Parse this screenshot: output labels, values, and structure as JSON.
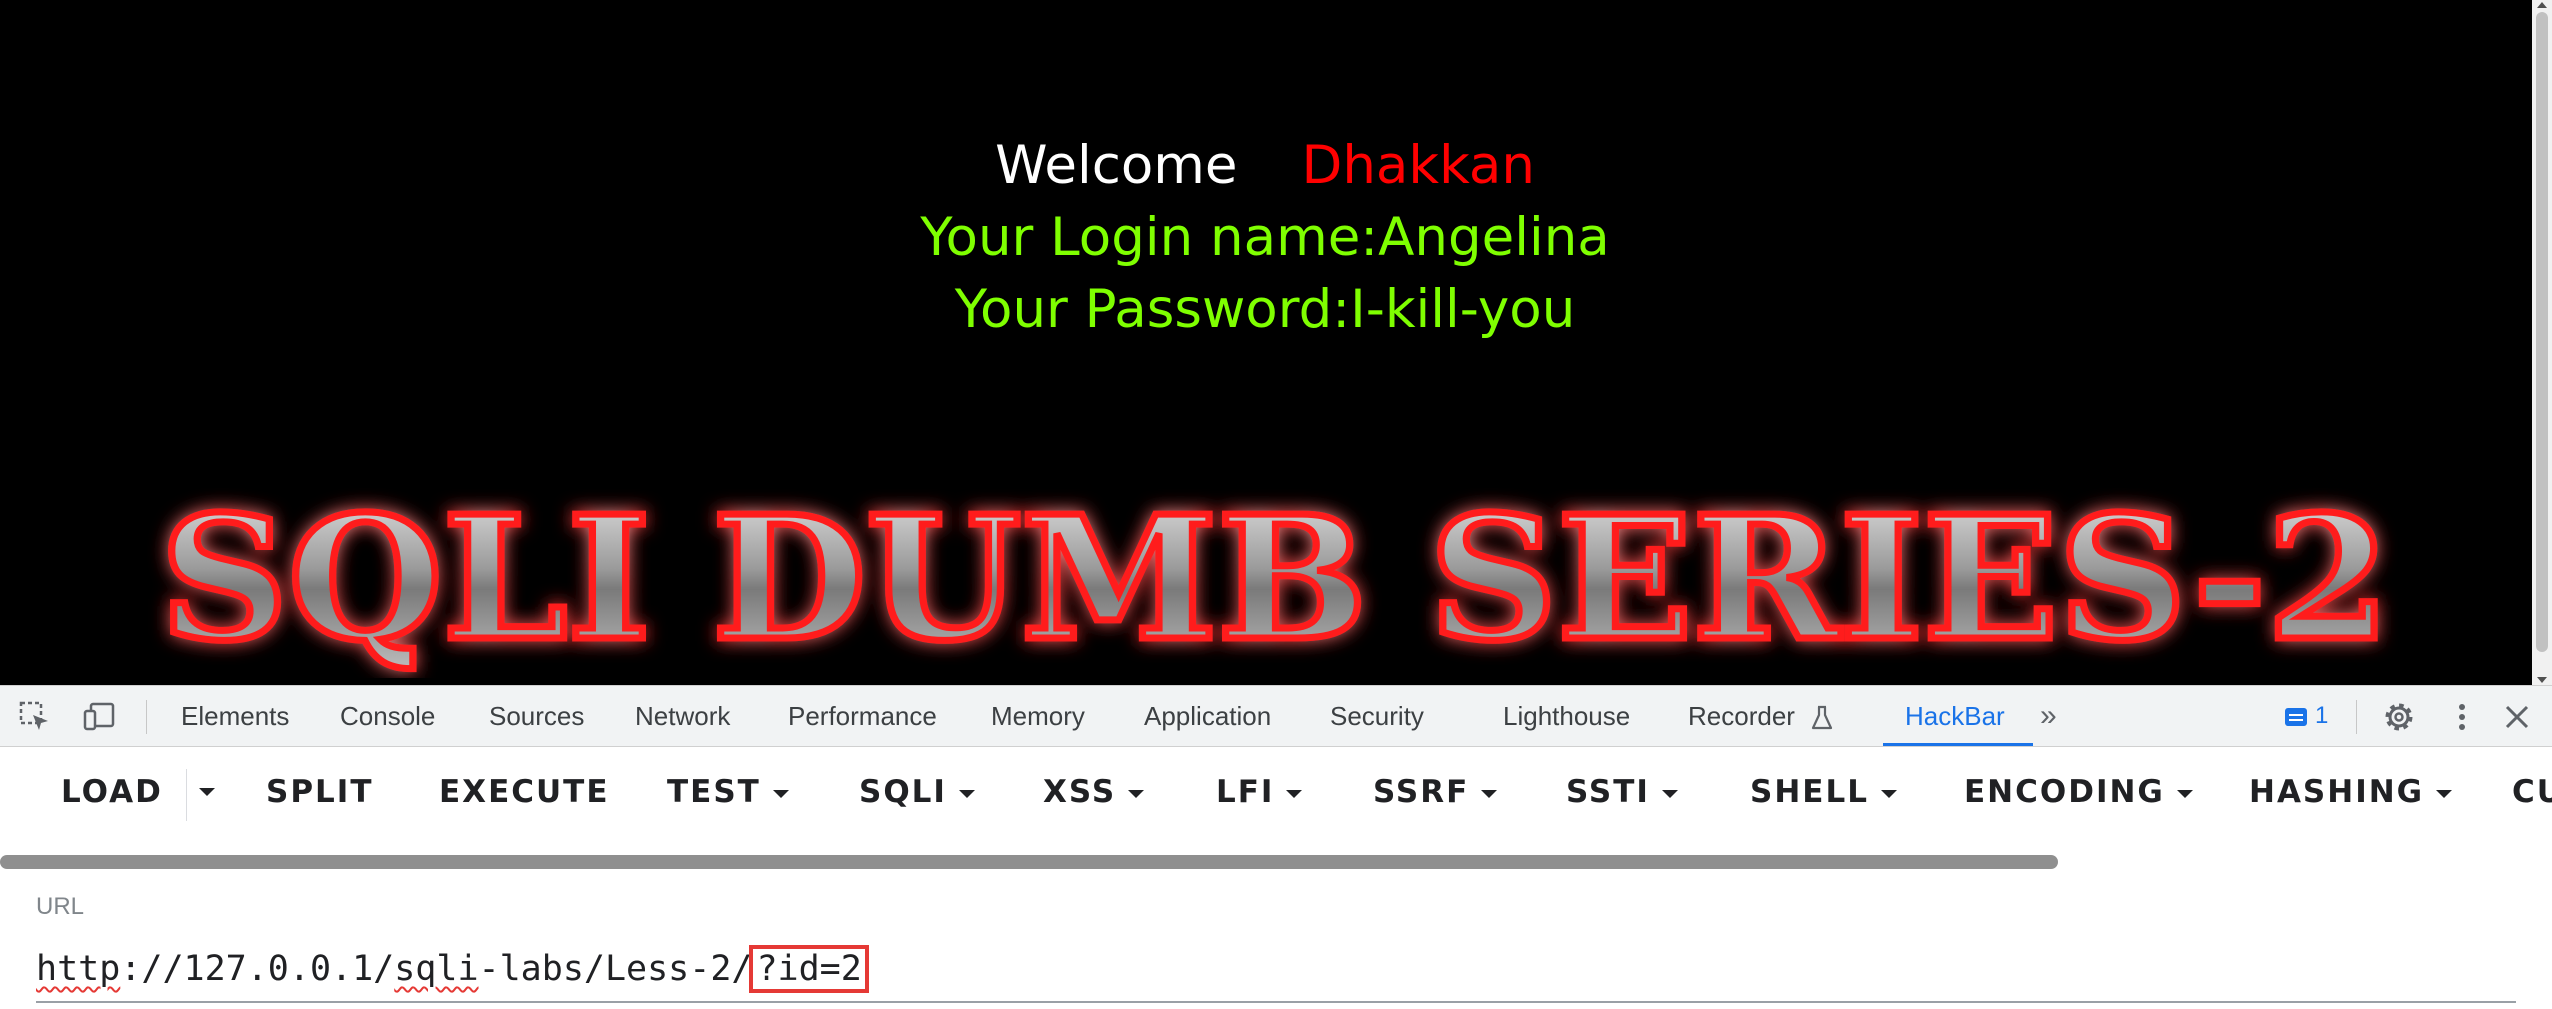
{
  "page": {
    "welcome_word": "Welcome",
    "welcome_name": "Dhakkan",
    "login_line": "Your Login name:Angelina",
    "password_line": "Your Password:I-kill-you",
    "banner_text": "SQLI DUMB SERIES-2",
    "colors": {
      "background": "#000000",
      "welcome": "#ffffff",
      "name": "#ff0000",
      "info": "#7fff00"
    }
  },
  "devtools": {
    "tabs": [
      "Elements",
      "Console",
      "Sources",
      "Network",
      "Performance",
      "Memory",
      "Application",
      "Security",
      "Lighthouse",
      "Recorder",
      "HackBar"
    ],
    "active_tab": "HackBar",
    "more_tabs_glyph": "»",
    "issues_count": "1",
    "icons": [
      "inspect-element-icon",
      "device-toolbar-icon",
      "recorder-flask-icon",
      "more-tabs-icon",
      "issues-icon",
      "settings-gear-icon",
      "more-vert-icon",
      "close-icon"
    ]
  },
  "hackbar": {
    "buttons": [
      "LOAD",
      "SPLIT",
      "EXECUTE",
      "TEST",
      "SQLI",
      "XSS",
      "LFI",
      "SSRF",
      "SSTI",
      "SHELL",
      "ENCODING",
      "HASHING",
      "CU"
    ],
    "url_label": "URL",
    "url_base_parts": [
      "http",
      "://127.0.0.1/",
      "sqli",
      "-labs/Less-2/"
    ],
    "url_highlighted": "?id=2"
  }
}
